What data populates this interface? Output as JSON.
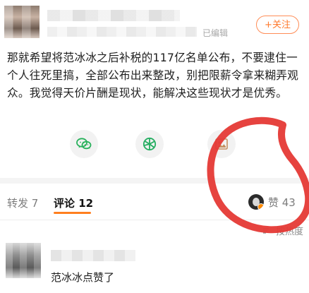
{
  "header": {
    "edited_text": "已编辑",
    "follow_label": "+关注"
  },
  "post": {
    "text": "那就希望将范冰冰之后补税的117亿名单公布，不要逮住一个人往死里搞，全部公布出来整改，别把限薪令拿来糊弄观众。我觉得天价片酬是现状，能解决这些现状才是优秀。"
  },
  "tabs": {
    "repost_label": "转发 7",
    "comment_label": "评论 12",
    "like_label": "赞 43"
  },
  "sort": {
    "label": "按热度"
  },
  "comment": {
    "text": "范冰冰点赞了"
  },
  "colors": {
    "accent": "#ff7f1f",
    "annotation_red": "#e53935"
  },
  "icons": {
    "share1": "wechat-icon",
    "share2": "moments-icon",
    "share3": "picture-icon",
    "sort": "sort-icon"
  }
}
